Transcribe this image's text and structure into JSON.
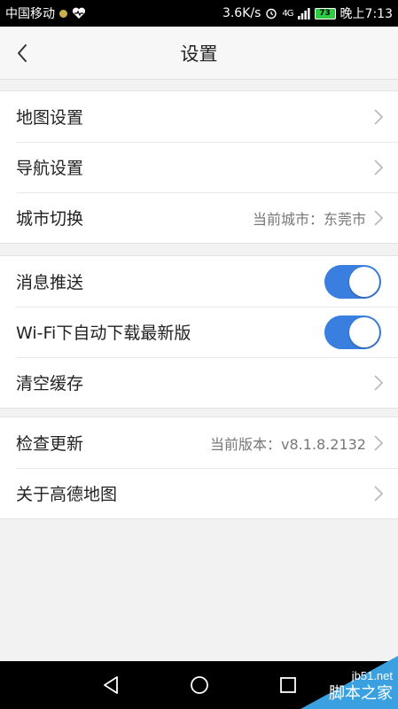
{
  "status_bar": {
    "carrier": "中国移动",
    "speed": "3.6K/s",
    "battery": "73",
    "time": "晚上7:13",
    "net": "4G"
  },
  "header": {
    "title": "设置"
  },
  "groups": [
    {
      "items": [
        {
          "label": "地图设置",
          "value": ""
        },
        {
          "label": "导航设置",
          "value": ""
        },
        {
          "label": "城市切换",
          "value": "当前城市：东莞市"
        }
      ]
    },
    {
      "items": [
        {
          "label": "消息推送",
          "toggle": true
        },
        {
          "label": "Wi-Fi下自动下载最新版",
          "toggle": true
        },
        {
          "label": "清空缓存",
          "value": ""
        }
      ]
    },
    {
      "items": [
        {
          "label": "检查更新",
          "value": "当前版本：v8.1.8.2132"
        },
        {
          "label": "关于高德地图",
          "value": ""
        }
      ]
    }
  ],
  "watermark": {
    "url": "jb51.net",
    "name": "脚本之家"
  },
  "colors": {
    "accent": "#3a7fe0",
    "background": "#f2f2f2"
  }
}
